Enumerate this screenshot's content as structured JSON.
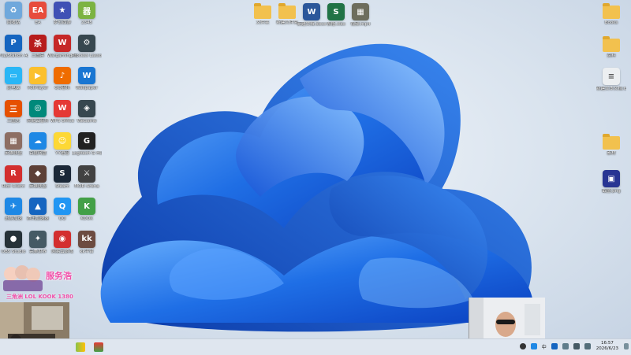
{
  "desktop": {
    "left_icons": [
      {
        "label": "回收站",
        "color": "#6fa8dc",
        "glyph": "♻"
      },
      {
        "label": "EA",
        "color": "#e74c3c",
        "glyph": "EA"
      },
      {
        "label": "梦幻西游",
        "color": "#3f51b5",
        "glyph": "★"
      },
      {
        "label": "2345",
        "color": "#7cb342",
        "glyph": "器"
      },
      {
        "label": "PlayStation Accessories",
        "color": "#1565c0",
        "glyph": "P"
      },
      {
        "label": "三国杀",
        "color": "#b71c1c",
        "glyph": "杀"
      },
      {
        "label": "Wargaming.net",
        "color": "#c62828",
        "glyph": "W"
      },
      {
        "label": "Process Lasso",
        "color": "#37474f",
        "glyph": "⚙"
      },
      {
        "label": "此电脑",
        "color": "#29b6f6",
        "glyph": "▭"
      },
      {
        "label": "PotPlayer",
        "color": "#fbc02d",
        "glyph": "▶"
      },
      {
        "label": "QQ音乐",
        "color": "#ef6c00",
        "glyph": "♪"
      },
      {
        "label": "Wallpaper",
        "color": "#1976d2",
        "glyph": "W"
      },
      {
        "label": "三国志",
        "color": "#e65100",
        "glyph": "三"
      },
      {
        "label": "网易云音乐",
        "color": "#00897b",
        "glyph": "◎"
      },
      {
        "label": "WPS Office",
        "color": "#e53935",
        "glyph": "W"
      },
      {
        "label": "WeGame",
        "color": "#37474f",
        "glyph": "◈"
      },
      {
        "label": "英雄联盟",
        "color": "#8d6e63",
        "glyph": "▦"
      },
      {
        "label": "百度网盘",
        "color": "#1e88e5",
        "glyph": "☁"
      },
      {
        "label": "YY语音",
        "color": "#fdd835",
        "glyph": "☺"
      },
      {
        "label": "Logitech G HUB",
        "color": "#212121",
        "glyph": "G"
      },
      {
        "label": "Riot Client",
        "color": "#d32f2f",
        "glyph": "R"
      },
      {
        "label": "英雄联盟",
        "color": "#5d4037",
        "glyph": "◆"
      },
      {
        "label": "Steam",
        "color": "#1b2838",
        "glyph": "S"
      },
      {
        "label": "MOD Arena",
        "color": "#424242",
        "glyph": "⚔"
      },
      {
        "label": "迅游加速",
        "color": "#1e88e5",
        "glyph": "✈"
      },
      {
        "label": "腾讯加速器",
        "color": "#1565c0",
        "glyph": "▲"
      },
      {
        "label": "QQ",
        "color": "#2196f3",
        "glyph": "Q"
      },
      {
        "label": "KOOK",
        "color": "#43a047",
        "glyph": "K"
      },
      {
        "label": "OBS Studio",
        "color": "#263238",
        "glyph": "●"
      },
      {
        "label": "完美世界",
        "color": "#455a64",
        "glyph": "✦"
      },
      {
        "label": "网易云游戏",
        "color": "#d32f2f",
        "glyph": "◉"
      },
      {
        "label": "kk平台",
        "color": "#6d4c41",
        "glyph": "kk"
      }
    ],
    "top_icons": [
      {
        "label": "文件夹",
        "type": "folder"
      },
      {
        "label": "新建文件夹",
        "type": "folder"
      },
      {
        "label": "新建文档.docx",
        "type": "doc",
        "color": "#2b579a",
        "glyph": "W"
      },
      {
        "label": "表格.xlsx",
        "type": "doc",
        "color": "#217346",
        "glyph": "S"
      },
      {
        "label": "视频.mp4",
        "type": "doc",
        "color": "#6d6d5d",
        "glyph": "▦"
      }
    ],
    "right_icons": [
      {
        "label": "Books",
        "type": "folder"
      },
      {
        "label": "资料",
        "type": "folder"
      },
      {
        "label": "新建文本文档.txt",
        "type": "doc",
        "color": "#eceff1",
        "glyph": "≡"
      },
      {
        "label": "素材",
        "type": "folder"
      },
      {
        "label": "截图.png",
        "type": "doc",
        "color": "#283593",
        "glyph": "▣"
      }
    ],
    "promo": {
      "big": "服务浩",
      "small": "三角洲 LOL KOOK 1380"
    }
  },
  "taskbar": {
    "ime": "中",
    "time": "16:57",
    "date": "2026/6/23"
  },
  "colors": {
    "bloom_dark": "#0a3fbf",
    "bloom_mid": "#1f6fe6",
    "bloom_light": "#5fa7ff"
  }
}
